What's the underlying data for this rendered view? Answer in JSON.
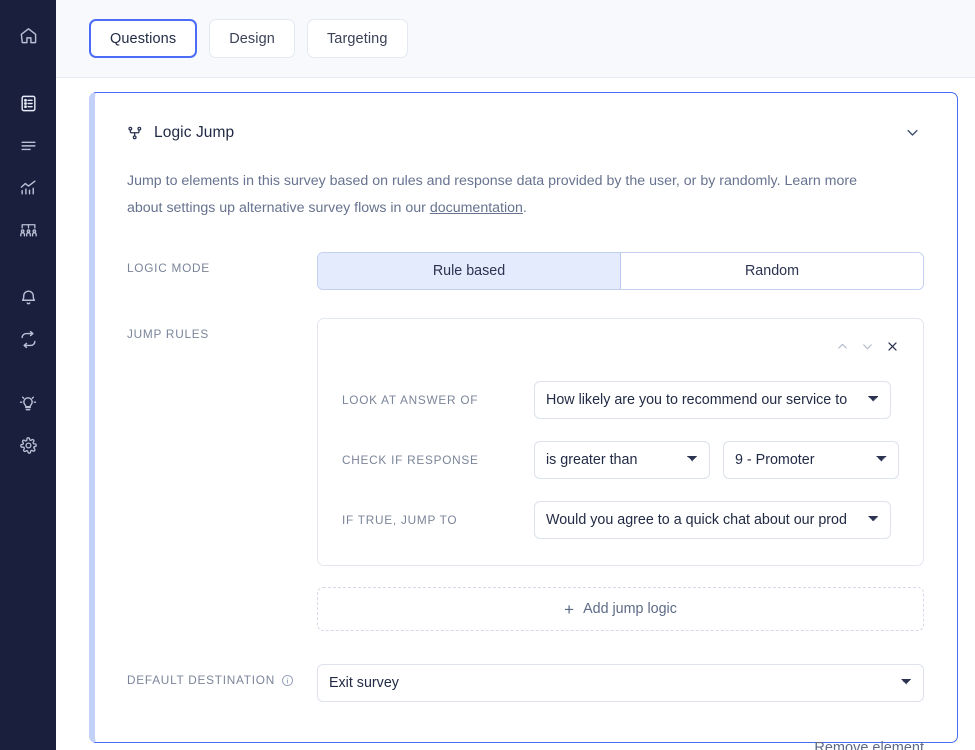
{
  "sidebar": {
    "items": [
      {
        "name": "home-icon",
        "label": "Home",
        "active": false
      },
      {
        "name": "surveys-icon",
        "label": "Surveys",
        "active": true
      },
      {
        "name": "list-lines-icon",
        "label": "Responses",
        "active": false
      },
      {
        "name": "analytics-icon",
        "label": "Analytics",
        "active": false
      },
      {
        "name": "audience-icon",
        "label": "Audience",
        "active": false
      },
      {
        "name": "bell-icon",
        "label": "Notifications",
        "active": false
      },
      {
        "name": "sync-icon",
        "label": "Integrations",
        "active": false
      },
      {
        "name": "lightbulb-icon",
        "label": "Insights",
        "active": false
      },
      {
        "name": "gear-icon",
        "label": "Settings",
        "active": false
      }
    ]
  },
  "tabs": [
    {
      "label": "Questions",
      "active": true
    },
    {
      "label": "Design",
      "active": false
    },
    {
      "label": "Targeting",
      "active": false
    }
  ],
  "card": {
    "title": "Logic Jump",
    "icon": "branch-icon",
    "collapse_icon": "chevron-down-icon",
    "description_part1": "Jump to elements in this survey based on rules and response data provided by the user, or by randomly. Learn more about settings up alternative survey flows in our ",
    "description_link": "documentation",
    "description_part2": ".",
    "logic_mode": {
      "label": "Logic mode",
      "options": [
        {
          "label": "Rule based",
          "active": true
        },
        {
          "label": "Random",
          "active": false
        }
      ]
    },
    "jump_rules": {
      "label": "Jump rules",
      "toolbar": [
        {
          "name": "move-up-icon",
          "glyph": "chevron-up"
        },
        {
          "name": "move-down-icon",
          "glyph": "chevron-down"
        },
        {
          "name": "remove-rule-icon",
          "glyph": "close"
        }
      ],
      "rows": [
        {
          "label": "Look at answer of",
          "fields": [
            {
              "name": "question-select",
              "value": "How likely are you to recommend our service to",
              "width": "wide"
            }
          ]
        },
        {
          "label": "Check if response",
          "fields": [
            {
              "name": "operator-select",
              "value": "is greater than",
              "width": "mid"
            },
            {
              "name": "value-select",
              "value": "9 - Promoter",
              "width": "mid2"
            }
          ]
        },
        {
          "label": "If true, jump to",
          "fields": [
            {
              "name": "destination-select",
              "value": "Would you agree to a quick chat about our prod",
              "width": "wide"
            }
          ]
        }
      ],
      "add_label": "Add jump logic",
      "add_icon": "plus-icon"
    },
    "default_destination": {
      "label": "Default destination",
      "info_icon": "info-icon",
      "value": "Exit survey"
    },
    "remove_label": "Remove element"
  },
  "colors": {
    "accent": "#4a6cf7",
    "accent_soft": "#c3d0f8",
    "seg_active_bg": "#e3ebfd",
    "sidebar_bg": "#191f3d",
    "header_bg": "#f7f9fc",
    "label_text": "#7b8599",
    "body_text": "#222b45"
  }
}
